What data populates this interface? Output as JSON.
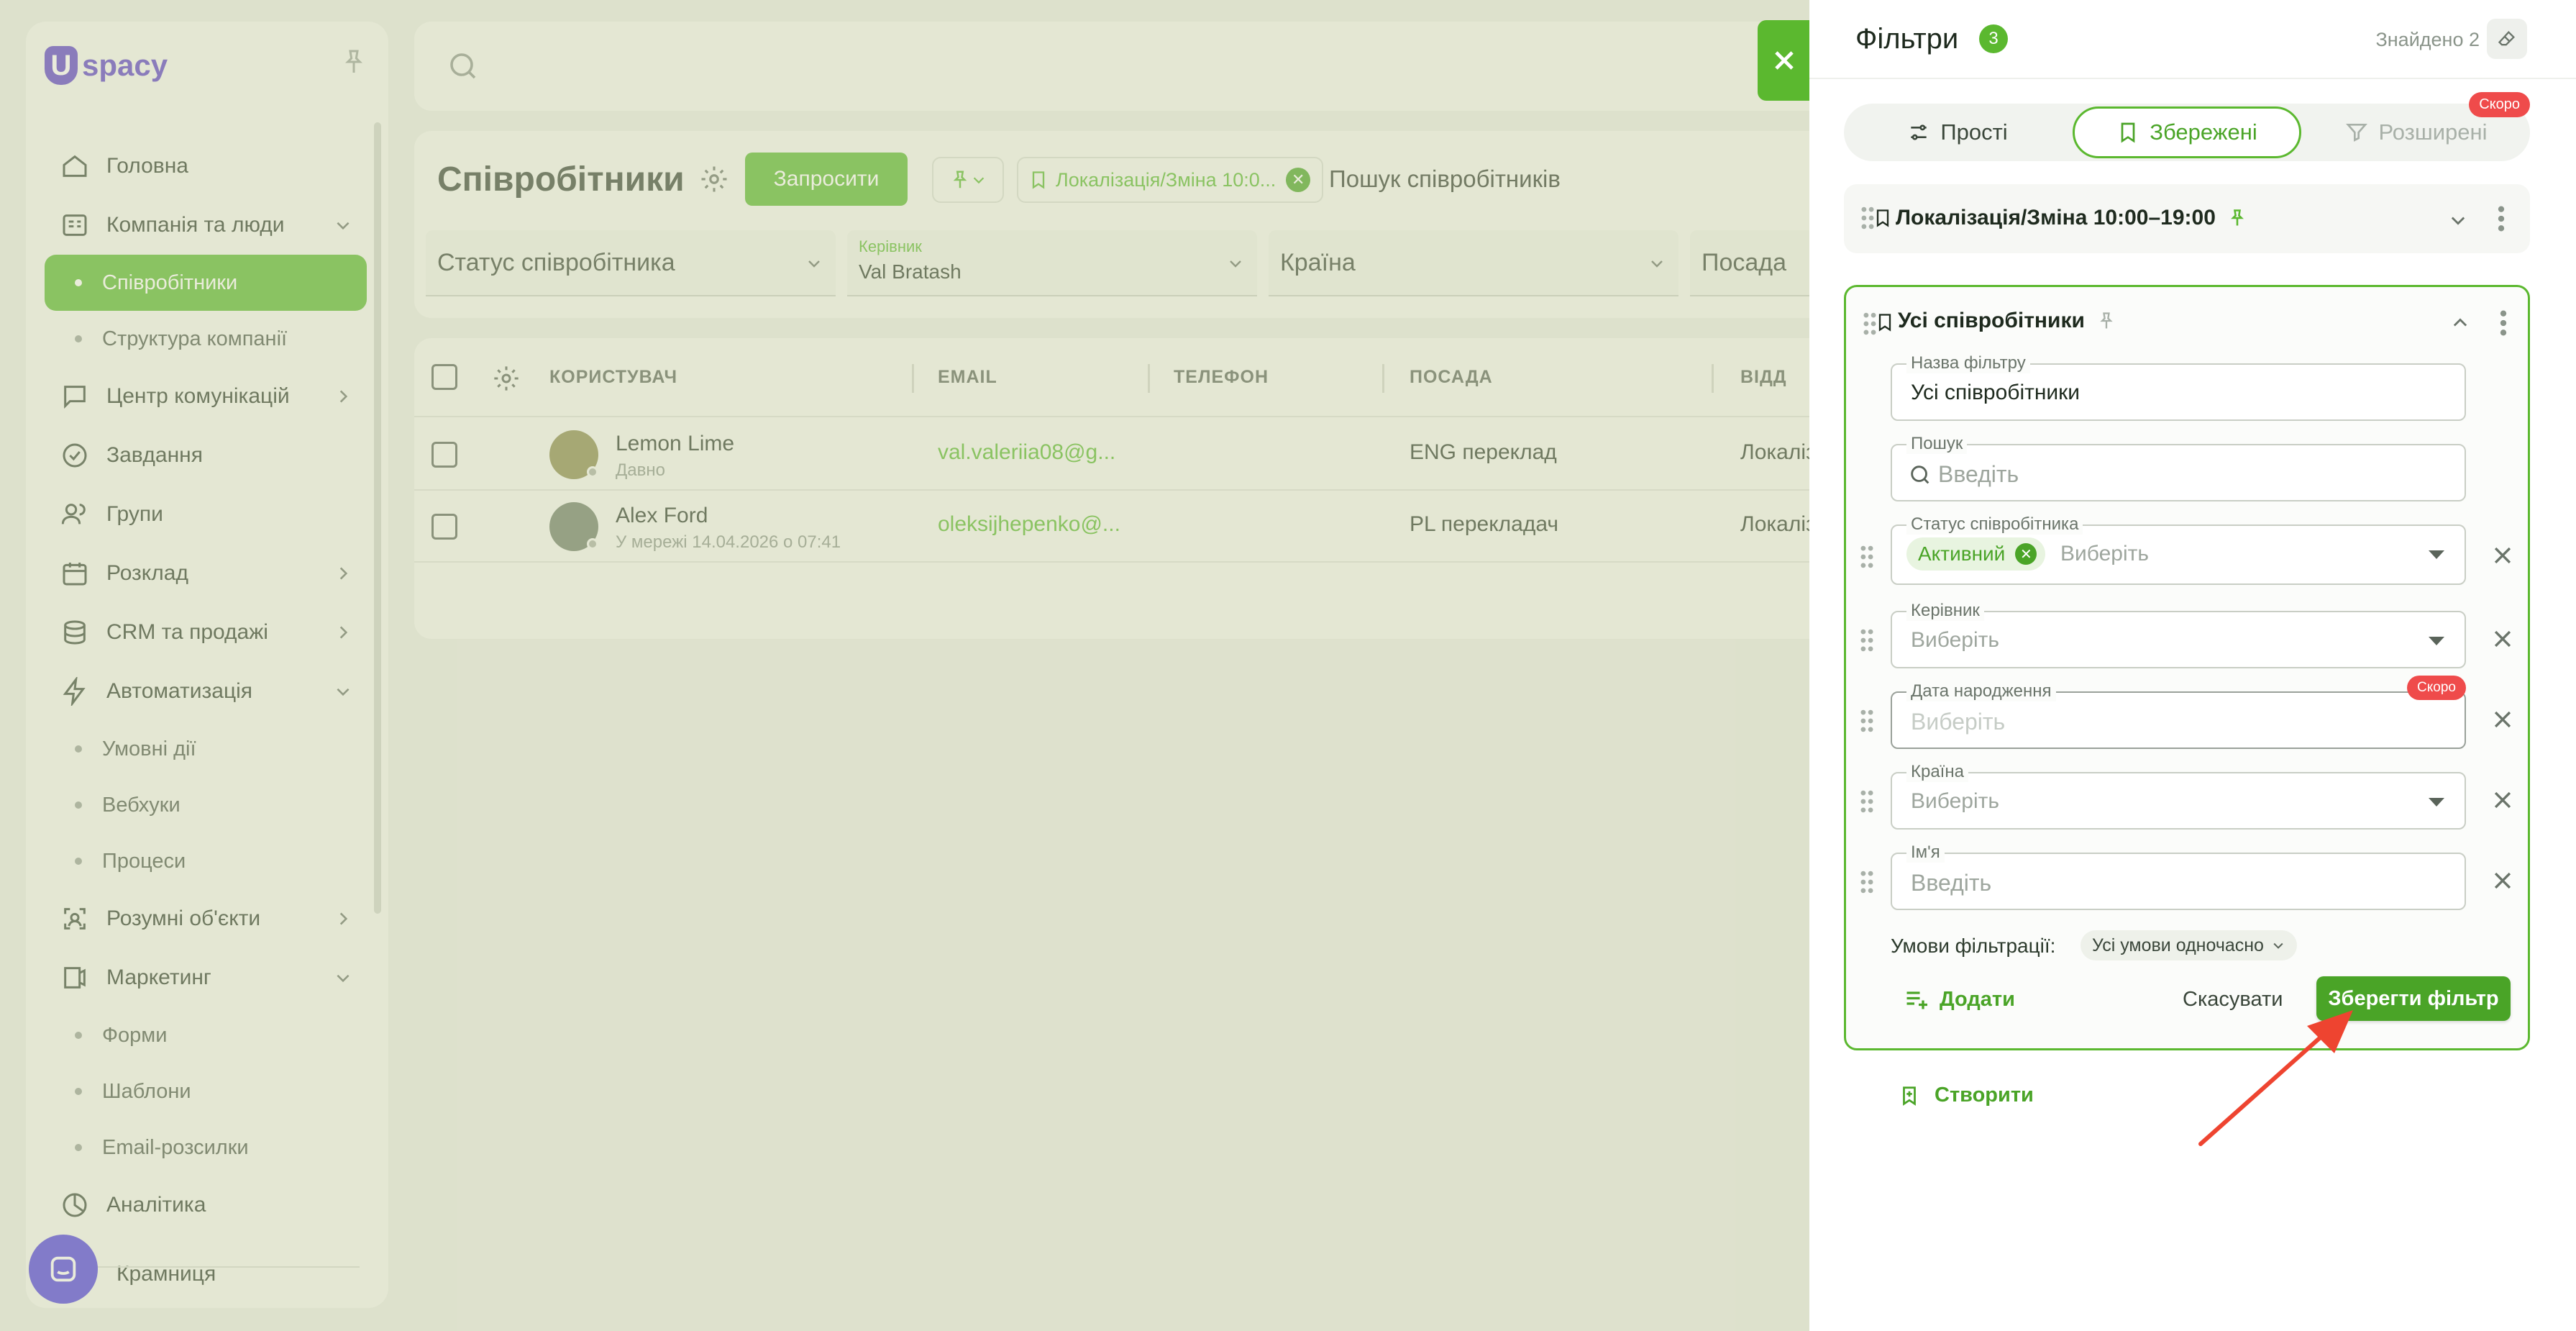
{
  "app": {
    "logo_letter": "U",
    "logo_text": "spacy"
  },
  "sidebar": {
    "items": [
      {
        "label": "Головна",
        "icon": "home-icon"
      },
      {
        "label": "Компанія та люди",
        "icon": "building-icon",
        "expanded": true
      },
      {
        "label": "Співробітники",
        "sub": true,
        "active": true
      },
      {
        "label": "Структура компанії",
        "sub": true
      },
      {
        "label": "Центр комунікацій",
        "icon": "chat-icon"
      },
      {
        "label": "Завдання",
        "icon": "check-circle-icon"
      },
      {
        "label": "Групи",
        "icon": "users-icon"
      },
      {
        "label": "Розклад",
        "icon": "calendar-icon"
      },
      {
        "label": "CRM та продажі",
        "icon": "database-icon"
      },
      {
        "label": "Автоматизація",
        "icon": "bolt-icon",
        "expanded": true
      },
      {
        "label": "Умовні дії",
        "sub": true
      },
      {
        "label": "Вебхуки",
        "sub": true
      },
      {
        "label": "Процеси",
        "sub": true
      },
      {
        "label": "Розумні об'єкти",
        "icon": "smart-object-icon"
      },
      {
        "label": "Маркетинг",
        "icon": "marketing-icon",
        "expanded": true
      },
      {
        "label": "Форми",
        "sub": true
      },
      {
        "label": "Шаблони",
        "sub": true
      },
      {
        "label": "Email-розсилки",
        "sub": true
      },
      {
        "label": "Аналітика",
        "icon": "analytics-icon"
      },
      {
        "label": "Крамниця",
        "icon": "store-icon"
      }
    ]
  },
  "page": {
    "title": "Співробітники",
    "invite_label": "Запросити",
    "saved_filter_chip": "Локалізація/Зміна 10:0...",
    "search_placeholder": "Пошук співробітників",
    "filters": {
      "status": "Статус співробітника",
      "manager_label": "Керівник",
      "manager_value": "Val Bratash",
      "country": "Країна",
      "position": "Посада"
    }
  },
  "table": {
    "columns": [
      "КОРИСТУВАЧ",
      "EMAIL",
      "ТЕЛЕФОН",
      "ПОСАДА",
      "ВІДД"
    ],
    "rows": [
      {
        "name": "Lemon Lime",
        "sub": "Давно",
        "email": "val.valeriia08@g...",
        "phone": "",
        "position": "ENG переклад",
        "dept": "Локаліз"
      },
      {
        "name": "Alex Ford",
        "sub": "У мережі 14.04.2026 о 07:41",
        "email": "oleksijhepenko@...",
        "phone": "",
        "position": "PL перекладач",
        "dept": "Локаліз"
      }
    ]
  },
  "drawer": {
    "title": "Фільтри",
    "count": "3",
    "found": "Знайдено 2",
    "tabs": {
      "simple": "Прості",
      "saved": "Збережені",
      "advanced": "Розширені",
      "advanced_badge": "Скоро"
    },
    "saved_item": "Локалізація/Зміна 10:00–19:00",
    "card": {
      "title": "Усі співробітники",
      "name_label": "Назва фільтру",
      "name_value": "Усі співробітники",
      "search_label": "Пошук",
      "search_placeholder": "Введіть",
      "status_label": "Статус співробітника",
      "status_chip": "Активний",
      "status_placeholder": "Виберіть",
      "manager_label": "Керівник",
      "manager_placeholder": "Виберіть",
      "birthday_label": "Дата народження",
      "birthday_placeholder": "Виберіть",
      "birthday_badge": "Скоро",
      "country_label": "Країна",
      "country_placeholder": "Виберіть",
      "firstname_label": "Ім'я",
      "firstname_placeholder": "Введіть",
      "conditions_label": "Умови фільтрації:",
      "conditions_value": "Усі умови одночасно",
      "add_label": "Додати",
      "cancel_label": "Скасувати",
      "save_label": "Зберегти фільтр"
    },
    "create_label": "Створити"
  },
  "colors": {
    "accent": "#5bb82f",
    "accent_dark": "#4aa427",
    "badge": "#ef4b4b",
    "brand": "#5a3ec8",
    "arrow": "#ee4430"
  }
}
